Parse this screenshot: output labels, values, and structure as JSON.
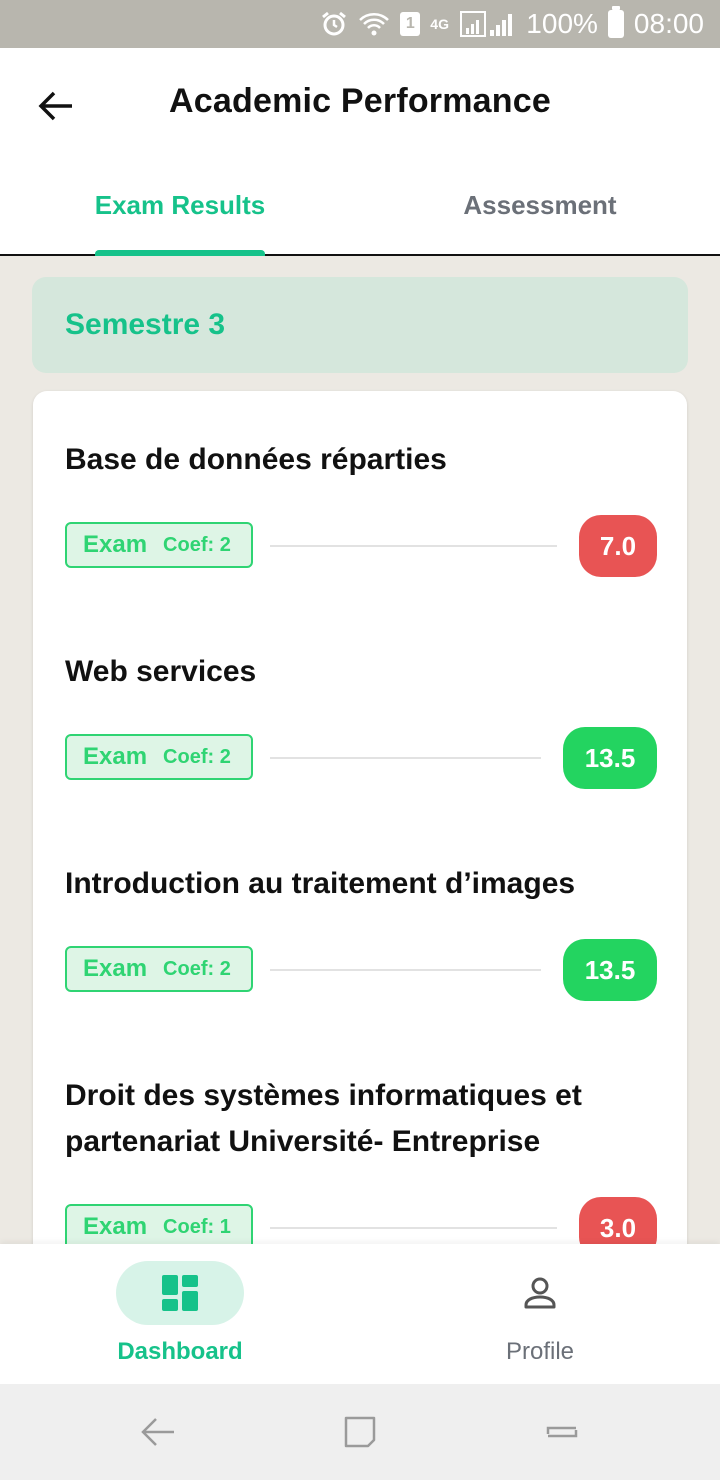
{
  "status_bar": {
    "sim_badge": "1",
    "network_label": "4G",
    "battery_text": "100%",
    "time": "08:00"
  },
  "header": {
    "title": "Academic Performance"
  },
  "tabs": [
    {
      "label": "Exam Results",
      "active": true
    },
    {
      "label": "Assessment",
      "active": false
    }
  ],
  "semester": {
    "label": "Semestre 3"
  },
  "courses": [
    {
      "name": "Base de données réparties",
      "type": "Exam",
      "coef": "Coef: 2",
      "grade": "7.0",
      "status": "low"
    },
    {
      "name": "Web services",
      "type": "Exam",
      "coef": "Coef: 2",
      "grade": "13.5",
      "status": "ok"
    },
    {
      "name": "Introduction au traitement d’images",
      "type": "Exam",
      "coef": "Coef: 2",
      "grade": "13.5",
      "status": "ok"
    },
    {
      "name": "Droit des systèmes informatiques et partenariat Université- Entreprise",
      "type": "Exam",
      "coef": "Coef: 1",
      "grade": "3.0",
      "status": "low"
    }
  ],
  "bottom_nav": [
    {
      "label": "Dashboard",
      "icon": "dashboard-icon",
      "active": true
    },
    {
      "label": "Profile",
      "icon": "person-icon",
      "active": false
    }
  ],
  "colors": {
    "accent": "#16c28a",
    "grade_low": "#e85454",
    "grade_ok": "#23d460",
    "semester_bg": "#d5e7dc"
  }
}
